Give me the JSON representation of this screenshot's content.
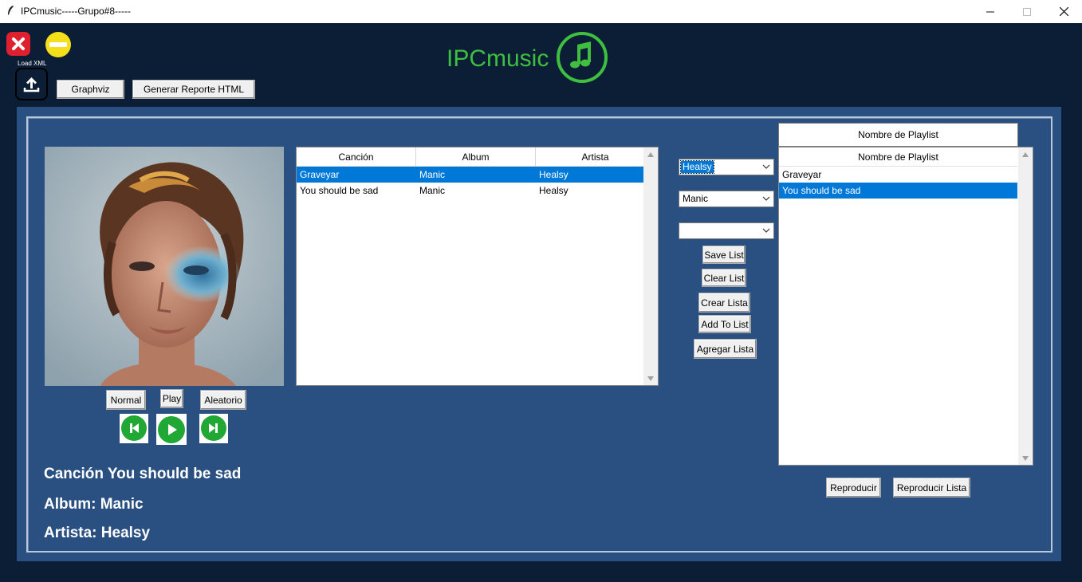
{
  "window": {
    "title": "IPCmusic-----Grupo#8-----",
    "controls": [
      "minimize",
      "maximize",
      "close"
    ]
  },
  "toolbar": {
    "load_label": "Load XML",
    "graphviz": "Graphviz",
    "reporte": "Generar Reporte HTML"
  },
  "logo": {
    "text": "IPCmusic"
  },
  "songs_table": {
    "columns": [
      "Canción",
      "Album",
      "Artista"
    ],
    "rows": [
      {
        "cancion": "Graveyar",
        "album": "Manic",
        "artista": "Healsy",
        "selected": true
      },
      {
        "cancion": "You should be sad",
        "album": "Manic",
        "artista": "Healsy",
        "selected": false
      }
    ]
  },
  "player": {
    "normal": "Normal",
    "play": "Play",
    "aleatorio": "Aleatorio",
    "accent_color": "#21a733"
  },
  "filters": {
    "artista": "Healsy",
    "album": "Manic",
    "tercero": ""
  },
  "list_actions": {
    "save": "Save List",
    "clear": "Clear List",
    "crear": "Crear Lista",
    "add": "Add To List",
    "agregar": "Agregar Lista"
  },
  "playlist": {
    "name_field": "Nombre de Playlist",
    "header": "Nombre de Playlist",
    "items": [
      {
        "label": "Graveyar",
        "selected": false
      },
      {
        "label": "You should be sad",
        "selected": true
      }
    ],
    "reproducir": "Reproducir",
    "reproducir_lista": "Reproducir Lista"
  },
  "now_playing": {
    "cancion": "Canción You should be sad",
    "album": "Album: Manic",
    "artista": "Artista: Healsy"
  },
  "colors": {
    "background": "#0b1e35",
    "panel": "#2a5081",
    "selection": "#0078d7",
    "logo": "#3fbf3f"
  }
}
